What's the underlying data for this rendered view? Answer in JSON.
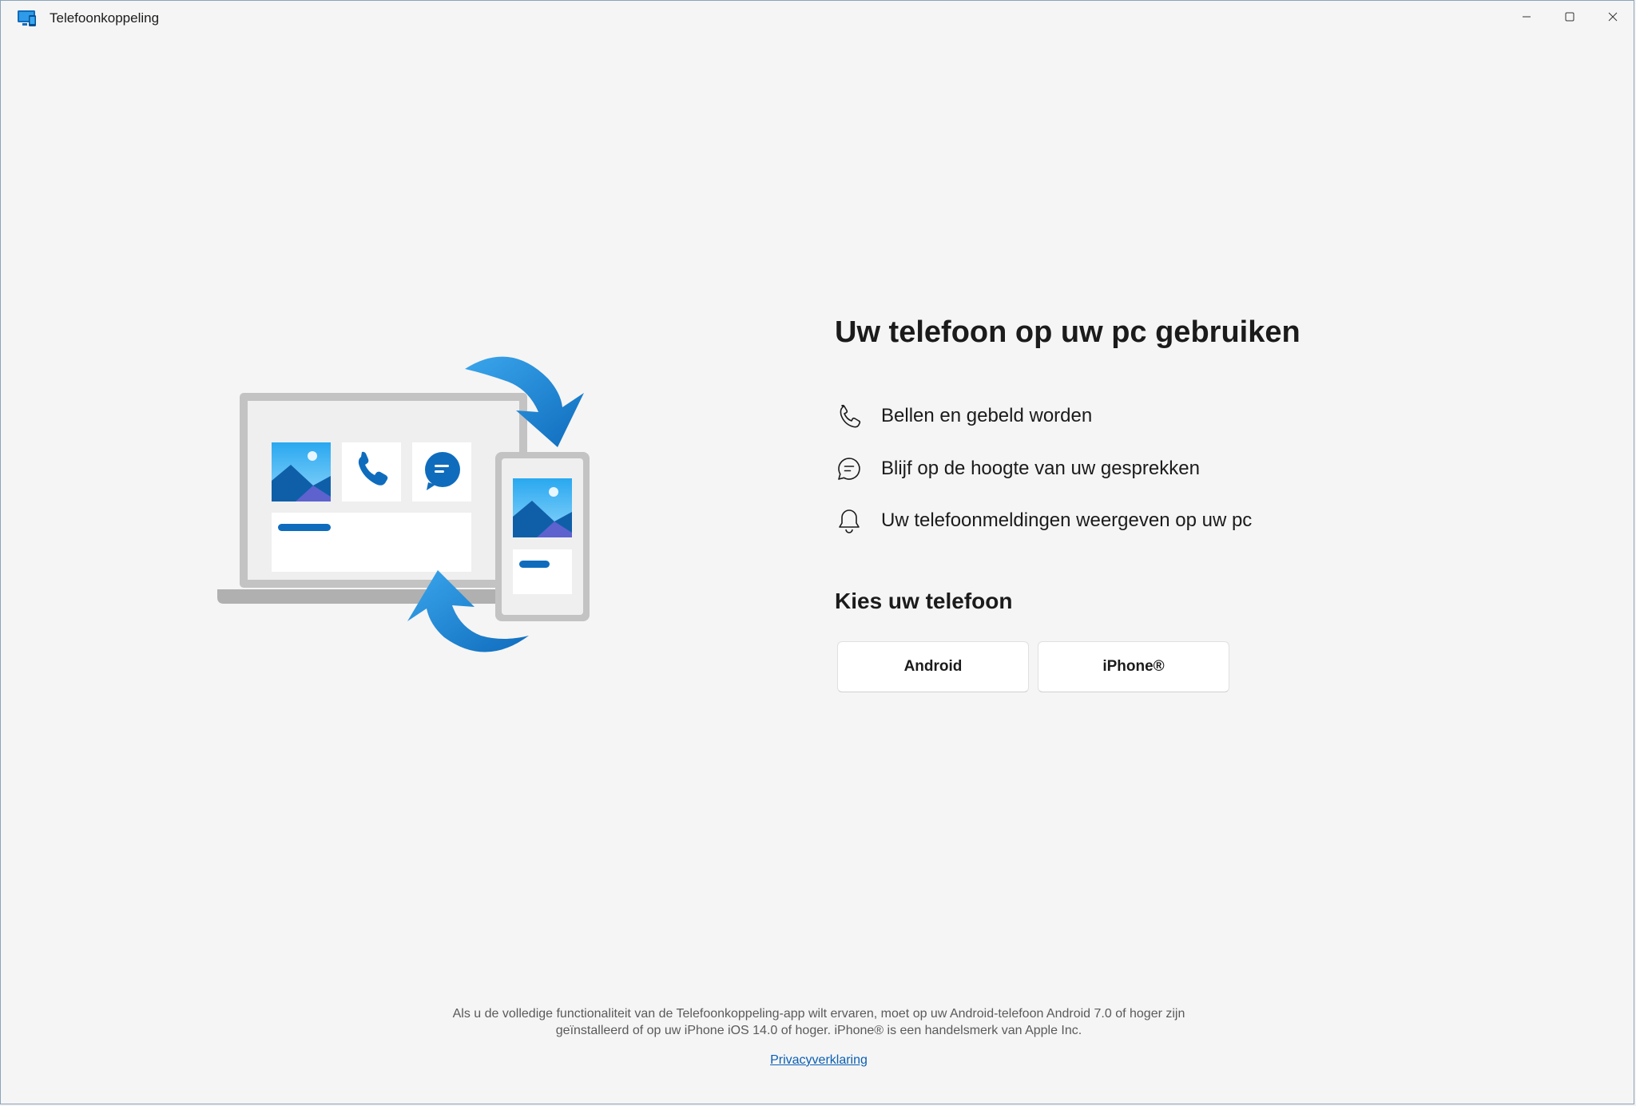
{
  "window": {
    "title": "Telefoonkoppeling",
    "icon": "phone-link-app-icon",
    "controls": {
      "minimize_icon": "minimize-icon",
      "maximize_icon": "maximize-icon",
      "close_icon": "close-icon"
    }
  },
  "main": {
    "title": "Uw telefoon op uw pc gebruiken",
    "features": [
      {
        "icon": "phone-icon",
        "label": "Bellen en gebeld worden"
      },
      {
        "icon": "chat-icon",
        "label": "Blijf op de hoogte van uw gesprekken"
      },
      {
        "icon": "bell-icon",
        "label": "Uw telefoonmeldingen weergeven op uw pc"
      }
    ],
    "choose_title": "Kies uw telefoon",
    "buttons": {
      "android": "Android",
      "iphone": "iPhone®"
    }
  },
  "footer": {
    "note_line1": "Als u de volledige functionaliteit van de Telefoonkoppeling-app wilt ervaren, moet op uw Android-telefoon Android 7.0 of hoger zijn",
    "note_line2": "geïnstalleerd of op uw iPhone iOS 14.0 of hoger. iPhone® is een handelsmerk van Apple Inc.",
    "privacy_link": "Privacyverklaring"
  },
  "colors": {
    "accent": "#0a5fb4",
    "arrow_blue": "#1a8fe0",
    "background": "#f5f5f5"
  }
}
